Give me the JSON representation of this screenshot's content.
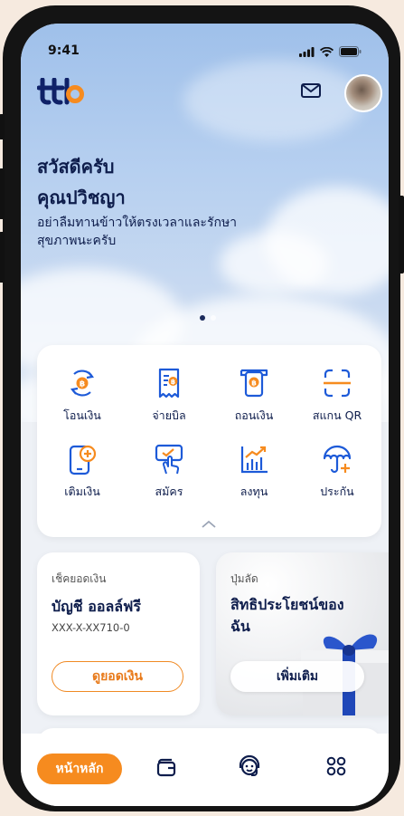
{
  "status_bar": {
    "time": "9:41"
  },
  "header": {
    "logo_text": "ttb",
    "mail_icon": "mail-icon",
    "avatar": "user-avatar"
  },
  "greeting": {
    "line1": "สวัสดีครับ",
    "line2": "คุณปวิชญา",
    "message": "อย่าลืมทานข้าวให้ตรงเวลาและรักษาสุขภาพนะครับ"
  },
  "carousel": {
    "total": 2,
    "active": 1
  },
  "menu": [
    {
      "label": "โอนเงิน",
      "icon": "transfer-icon"
    },
    {
      "label": "จ่ายบิล",
      "icon": "bill-icon"
    },
    {
      "label": "ถอนเงิน",
      "icon": "withdraw-icon"
    },
    {
      "label": "สแกน QR",
      "icon": "scan-qr-icon"
    },
    {
      "label": "เติมเงิน",
      "icon": "topup-icon"
    },
    {
      "label": "สมัคร",
      "icon": "apply-icon"
    },
    {
      "label": "ลงทุน",
      "icon": "invest-icon"
    },
    {
      "label": "ประกัน",
      "icon": "insurance-icon"
    }
  ],
  "balance_card": {
    "label": "เช็คยอดเงิน",
    "account_name": "บัญชี ออลล์ฟรี",
    "account_number": "XXX-X-XX710-0",
    "button": "ดูยอดเงิน"
  },
  "promo_card": {
    "label": "ปุ่มลัด",
    "title": "สิทธิประโยชน์ของฉัน",
    "button": "เพิ่มเติม"
  },
  "bottom_nav": {
    "home_label": "หน้าหลัก",
    "items": [
      "wallet-icon",
      "support-icon",
      "apps-grid-icon"
    ]
  },
  "colors": {
    "primary": "#0e1d4c",
    "accent": "#f68b1f",
    "icon_blue": "#1d5ad8"
  }
}
